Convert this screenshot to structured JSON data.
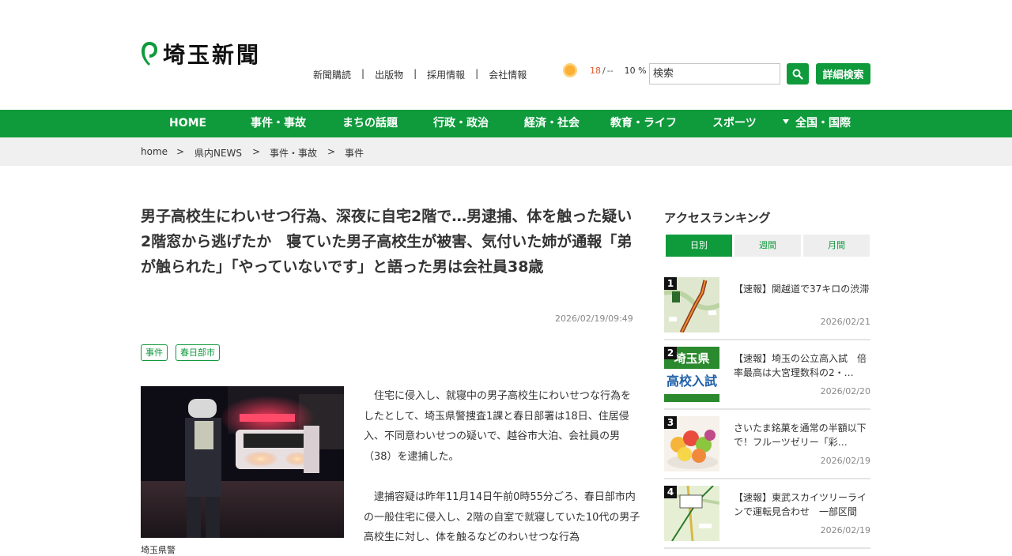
{
  "header": {
    "logo_text": "埼玉新聞",
    "util_links": [
      "新聞購読",
      "出版物",
      "採用情報",
      "会社情報"
    ],
    "weather": {
      "icon": "sun-icon",
      "temp_high": "18",
      "temp_sep": "/",
      "temp_low": "--",
      "rain": "10 %"
    },
    "search": {
      "placeholder": "検索",
      "adv_label": "詳細検索"
    }
  },
  "nav": {
    "items": [
      "HOME",
      "事件・事故",
      "まちの話題",
      "行政・政治",
      "経済・社会",
      "教育・ライフ",
      "スポーツ",
      "全国・国際"
    ]
  },
  "breadcrumb": [
    "home",
    "県内NEWS",
    "事件・事故",
    "事件"
  ],
  "breadcrumb_sep": ">",
  "article": {
    "title": "男子高校生にわいせつ行為、深夜に自宅2階で…男逮捕、体を触った疑い　2階窓から逃げたか　寝ていた男子高校生が被害、気付いた姉が通報「弟が触られた」「やっていないです」と語った男は会社員38歳",
    "date": "2026/02/19/09:49",
    "tags": [
      "事件",
      "春日部市"
    ],
    "photo_caption": "埼玉県警",
    "paragraphs": [
      "住宅に侵入し、就寝中の男子高校生にわいせつな行為をしたとして、埼玉県警捜査1課と春日部署は18日、住居侵入、不同意わいせつの疑いで、越谷市大泊、会社員の男（38）を逮捕した。",
      "逮捕容疑は昨年11月14日午前0時55分ごろ、春日部市内の一般住宅に侵入し、2階の自室で就寝していた10代の男子高校生に対し、体を触るなどのわいせつな行為"
    ]
  },
  "sidebar": {
    "title": "アクセスランキング",
    "tabs": [
      "日別",
      "週間",
      "月間"
    ],
    "active_tab": "日別",
    "ranking": [
      {
        "rank": "1",
        "title": "【速報】関越道で37キロの渋滞",
        "date": "2026/02/21"
      },
      {
        "rank": "2",
        "title": "【速報】埼玉の公立高入試　倍率最高は大宮理数科の2・…",
        "date": "2026/02/20",
        "thumb_text_1": "埼玉県",
        "thumb_text_2": "高校入試"
      },
      {
        "rank": "3",
        "title": "さいたま銘菓を通常の半額以下で！フルーツゼリー「彩…",
        "date": "2026/02/19"
      },
      {
        "rank": "4",
        "title": "【速報】東武スカイツリーラインで運転見合わせ　一部区間",
        "date": "2026/02/19"
      }
    ]
  },
  "colors": {
    "accent": "#0f9a3c"
  }
}
